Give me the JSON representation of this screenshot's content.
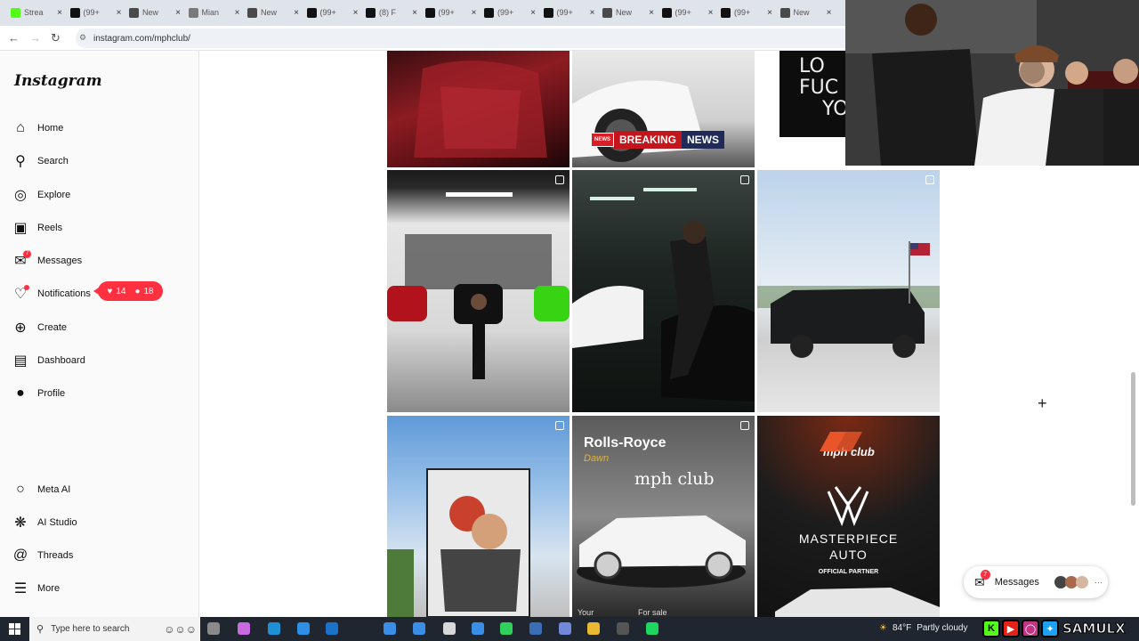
{
  "browser": {
    "tabs": [
      {
        "label": "Strea",
        "icon": "kick-icon",
        "color": "#53fc18"
      },
      {
        "label": "(99+",
        "icon": "tiktok-icon",
        "color": "#111111"
      },
      {
        "label": "New",
        "icon": "chrome-icon",
        "color": "#4a4a4a"
      },
      {
        "label": "Mian",
        "icon": "page-icon",
        "color": "#7a7a7a"
      },
      {
        "label": "New",
        "icon": "chrome-icon",
        "color": "#4a4a4a"
      },
      {
        "label": "(99+",
        "icon": "tiktok-icon",
        "color": "#111111"
      },
      {
        "label": "(8) F",
        "icon": "x-icon",
        "color": "#111111"
      },
      {
        "label": "(99+",
        "icon": "tiktok-icon",
        "color": "#111111"
      },
      {
        "label": "(99+",
        "icon": "tiktok-icon",
        "color": "#111111"
      },
      {
        "label": "(99+",
        "icon": "tiktok-icon",
        "color": "#111111"
      },
      {
        "label": "New",
        "icon": "chrome-icon",
        "color": "#4a4a4a"
      },
      {
        "label": "(99+",
        "icon": "tiktok-icon",
        "color": "#111111"
      },
      {
        "label": "(99+",
        "icon": "tiktok-icon",
        "color": "#111111"
      },
      {
        "label": "New",
        "icon": "chrome-icon",
        "color": "#4a4a4a"
      }
    ],
    "url": "instagram.com/mphclub/"
  },
  "sidebar": {
    "logo": "Instagram",
    "items": [
      {
        "label": "Home",
        "icon": "home-icon"
      },
      {
        "label": "Search",
        "icon": "search-icon"
      },
      {
        "label": "Explore",
        "icon": "compass-icon"
      },
      {
        "label": "Reels",
        "icon": "reels-icon"
      },
      {
        "label": "Messages",
        "icon": "messenger-icon",
        "badge": "7"
      },
      {
        "label": "Notifications",
        "icon": "heart-icon"
      },
      {
        "label": "Create",
        "icon": "plus-square-icon"
      },
      {
        "label": "Dashboard",
        "icon": "chart-icon"
      },
      {
        "label": "Profile",
        "icon": "avatar-icon"
      }
    ],
    "bottom_items": [
      {
        "label": "Meta AI",
        "icon": "meta-ai-icon"
      },
      {
        "label": "AI Studio",
        "icon": "ai-studio-icon"
      },
      {
        "label": "Threads",
        "icon": "threads-icon"
      },
      {
        "label": "More",
        "icon": "menu-icon"
      }
    ],
    "notification_popup": {
      "likes": "14",
      "followers": "18"
    }
  },
  "posts": {
    "breaking_badge": "NEWS",
    "breaking_text": "BREAKING",
    "breaking_news": "NEWS",
    "poster_text_1": "LO",
    "poster_text_2": "FUC",
    "poster_text_3": "YO",
    "rolls_title": "Rolls-Royce",
    "rolls_model": "Dawn",
    "rolls_brand": "mph club",
    "rolls_bottom_left": "Your",
    "rolls_bottom_right": "For sale",
    "partner_logo": "mph club",
    "partner_name_1": "MASTERPIECE",
    "partner_name_2": "AUTO",
    "partner_label": "OFFICIAL PARTNER"
  },
  "messages_pill": {
    "label": "Messages",
    "badge": "7",
    "more": "···"
  },
  "taskbar": {
    "search_placeholder": "Type here to search",
    "temperature": "84°F",
    "weather": "Partly cloudy"
  },
  "overlay": {
    "name": "SAMULX"
  },
  "colors": {
    "instagram_red": "#ff3040",
    "accent_kick": "#53fc18"
  }
}
